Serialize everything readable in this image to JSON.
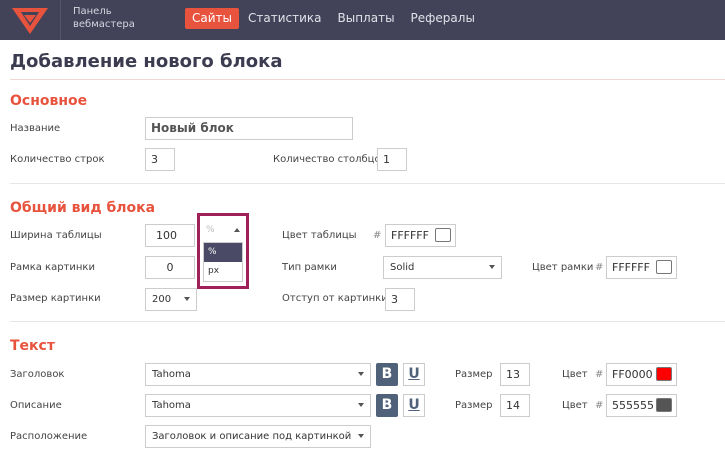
{
  "header": {
    "brand_line1": "Панель",
    "brand_line2": "вебмастера",
    "nav": [
      "Сайты",
      "Статистика",
      "Выплаты",
      "Рефералы"
    ]
  },
  "page_title": "Добавление нового блока",
  "basic": {
    "title": "Основное",
    "name_label": "Название",
    "name_value": "Новый блок",
    "rows_label": "Количество строк",
    "rows_value": "3",
    "cols_label": "Количество столбцов",
    "cols_value": "1"
  },
  "view": {
    "title": "Общий вид блока",
    "width_label": "Ширина таблицы",
    "width_value": "100",
    "unit_selected": "%",
    "unit_options": [
      "%",
      "px"
    ],
    "table_color_label": "Цвет таблицы",
    "table_color_value": "FFFFFF",
    "img_frame_label": "Рамка картинки",
    "img_frame_value": "0",
    "frame_type_label": "Тип рамки",
    "frame_type_value": "Solid",
    "frame_color_label": "Цвет рамки",
    "frame_color_value": "FFFFFF",
    "img_size_label": "Размер картинки",
    "img_size_value": "200",
    "img_offset_label": "Отступ от картинки",
    "img_offset_value": "3",
    "hash": "#"
  },
  "text": {
    "title": "Текст",
    "heading_label": "Заголовок",
    "heading_font": "Tahoma",
    "heading_size_label": "Размер",
    "heading_size": "13",
    "heading_color_label": "Цвет",
    "heading_color": "FF0000",
    "desc_label": "Описание",
    "desc_font": "Tahoma",
    "desc_size_label": "Размер",
    "desc_size": "14",
    "desc_color_label": "Цвет",
    "desc_color": "555555",
    "layout_label": "Расположение",
    "layout_value": "Заголовок и описание под картинкой",
    "bold_btn": "B",
    "underline_btn": "U"
  },
  "colors": {
    "accent": "#e8533e",
    "topbar": "#424259",
    "highlight_border": "#a0205a",
    "heading_swatch": "#ff0000",
    "desc_swatch": "#555555",
    "white_swatch": "#ffffff"
  }
}
